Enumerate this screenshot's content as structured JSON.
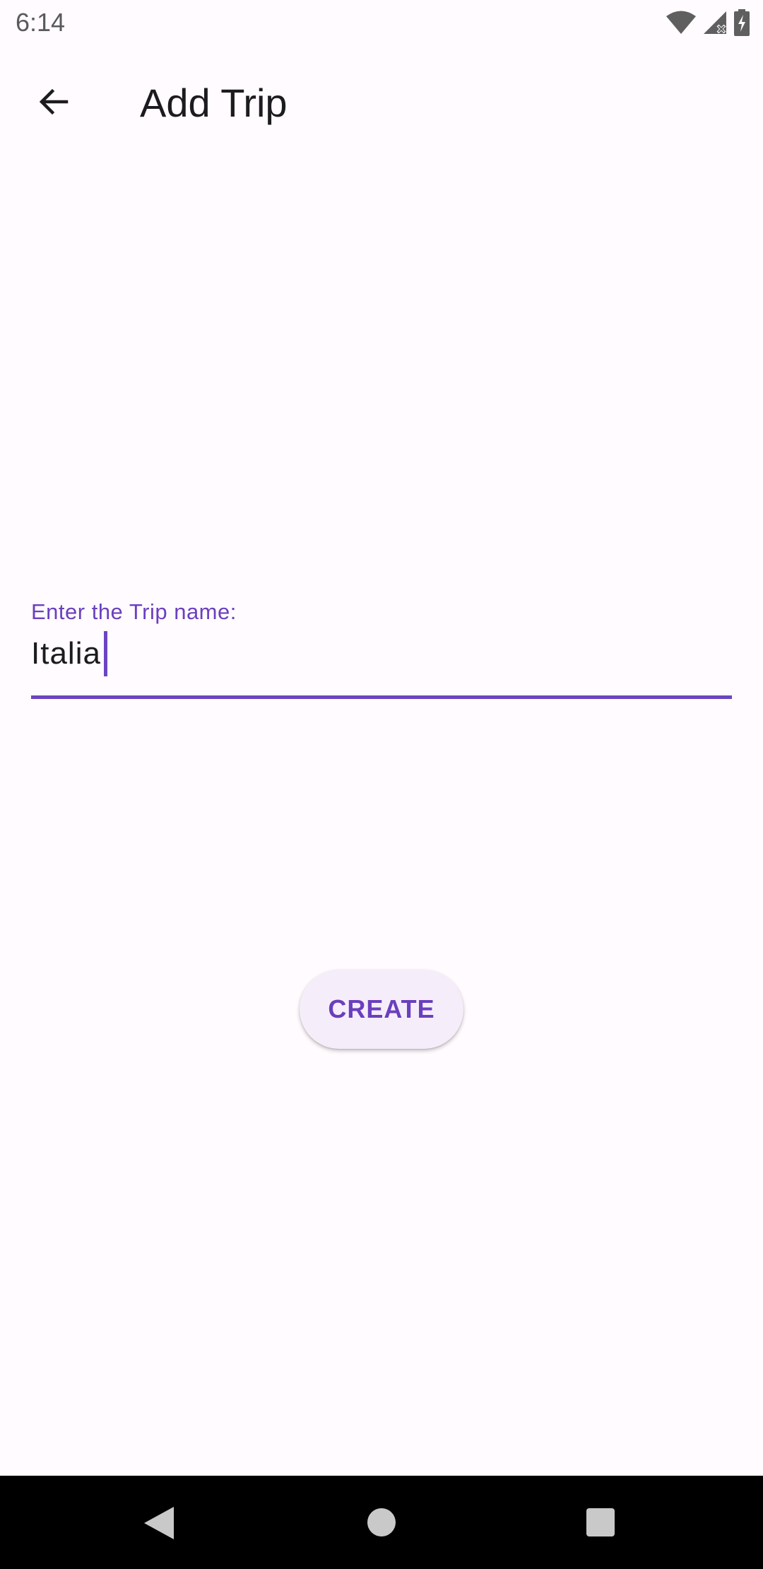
{
  "status_bar": {
    "time": "6:14",
    "icons": [
      "wifi-icon",
      "cell-signal-icon",
      "battery-charging-icon"
    ]
  },
  "app_bar": {
    "title": "Add Trip",
    "back_icon": "arrow-back-icon"
  },
  "form": {
    "trip_name": {
      "label": "Enter the Trip name:",
      "value": "Italia"
    }
  },
  "actions": {
    "create_label": "CREATE"
  },
  "navigation_bar": {
    "icons": [
      "nav-back-icon",
      "nav-home-icon",
      "nav-recents-icon"
    ]
  },
  "colors": {
    "accent": "#6A45C0",
    "background": "#FFFBFE",
    "button_surface": "#F5EEFA",
    "text_primary": "#1C1B1F"
  }
}
